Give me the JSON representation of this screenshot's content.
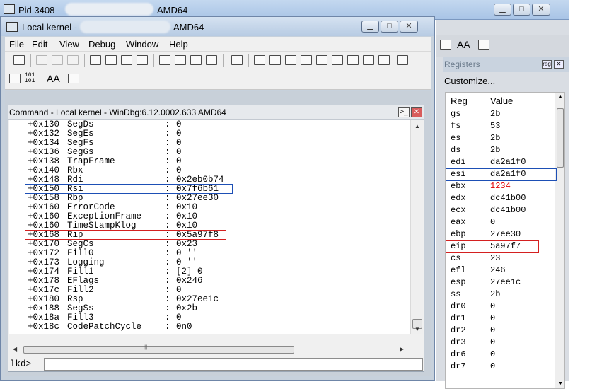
{
  "back_window": {
    "title_left": "Pid 3408 -",
    "title_right": "AMD64"
  },
  "front_window": {
    "title_left": "Local kernel -",
    "title_right": "AMD64"
  },
  "window_buttons": {
    "minimize": "▁",
    "maximize": "□",
    "close": "✕"
  },
  "menu": [
    "File",
    "Edit",
    "View",
    "Debug",
    "Window",
    "Help"
  ],
  "toolbar2": {
    "radix_label": "101\n101",
    "font_label": "AA"
  },
  "command_pane": {
    "title": "Command - Local kernel - WinDbg:6.12.0002.633 AMD64",
    "prompt": "lkd>",
    "input_value": "",
    "lines": [
      {
        "off": "+0x130",
        "field": "SegDs",
        "value": "0"
      },
      {
        "off": "+0x132",
        "field": "SegEs",
        "value": "0"
      },
      {
        "off": "+0x134",
        "field": "SegFs",
        "value": "0"
      },
      {
        "off": "+0x136",
        "field": "SegGs",
        "value": "0"
      },
      {
        "off": "+0x138",
        "field": "TrapFrame",
        "value": "0"
      },
      {
        "off": "+0x140",
        "field": "Rbx",
        "value": "0"
      },
      {
        "off": "+0x148",
        "field": "Rdi",
        "value": "0x2eb0b74"
      },
      {
        "off": "+0x150",
        "field": "Rsi",
        "value": "0x7f6b61"
      },
      {
        "off": "+0x158",
        "field": "Rbp",
        "value": "0x27ee30"
      },
      {
        "off": "+0x160",
        "field": "ErrorCode",
        "value": "0x10"
      },
      {
        "off": "+0x160",
        "field": "ExceptionFrame",
        "value": "0x10"
      },
      {
        "off": "+0x160",
        "field": "TimeStampKlog",
        "value": "0x10"
      },
      {
        "off": "+0x168",
        "field": "Rip",
        "value": "0x5a97f8"
      },
      {
        "off": "+0x170",
        "field": "SegCs",
        "value": "0x23"
      },
      {
        "off": "+0x172",
        "field": "Fill0",
        "value": "0 ''"
      },
      {
        "off": "+0x173",
        "field": "Logging",
        "value": "0 ''"
      },
      {
        "off": "+0x174",
        "field": "Fill1",
        "value": "[2] 0"
      },
      {
        "off": "+0x178",
        "field": "EFlags",
        "value": "0x246"
      },
      {
        "off": "+0x17c",
        "field": "Fill2",
        "value": "0"
      },
      {
        "off": "+0x180",
        "field": "Rsp",
        "value": "0x27ee1c"
      },
      {
        "off": "+0x188",
        "field": "SegSs",
        "value": "0x2b"
      },
      {
        "off": "+0x18a",
        "field": "Fill3",
        "value": "0"
      },
      {
        "off": "+0x18c",
        "field": "CodePatchCycle",
        "value": "0n0"
      }
    ]
  },
  "registers_pane": {
    "title": "Registers",
    "customize": "Customize...",
    "col_reg": "Reg",
    "col_value": "Value",
    "rows": [
      {
        "reg": "gs",
        "value": "2b"
      },
      {
        "reg": "fs",
        "value": "53"
      },
      {
        "reg": "es",
        "value": "2b"
      },
      {
        "reg": "ds",
        "value": "2b"
      },
      {
        "reg": "edi",
        "value": "da2a1f0"
      },
      {
        "reg": "esi",
        "value": "da2a1f0"
      },
      {
        "reg": "ebx",
        "value": "1234"
      },
      {
        "reg": "edx",
        "value": "dc41b00"
      },
      {
        "reg": "ecx",
        "value": "dc41b00"
      },
      {
        "reg": "eax",
        "value": "0"
      },
      {
        "reg": "ebp",
        "value": "27ee30"
      },
      {
        "reg": "eip",
        "value": "5a97f7"
      },
      {
        "reg": "cs",
        "value": "23"
      },
      {
        "reg": "efl",
        "value": "246"
      },
      {
        "reg": "esp",
        "value": "27ee1c"
      },
      {
        "reg": "ss",
        "value": "2b"
      },
      {
        "reg": "dr0",
        "value": "0"
      },
      {
        "reg": "dr1",
        "value": "0"
      },
      {
        "reg": "dr2",
        "value": "0"
      },
      {
        "reg": "dr3",
        "value": "0"
      },
      {
        "reg": "dr6",
        "value": "0"
      },
      {
        "reg": "dr7",
        "value": "0"
      }
    ]
  },
  "colors": {
    "changed_value": "#e00000",
    "highlight_blue": "#1d4fb5",
    "highlight_red": "#d42020"
  }
}
